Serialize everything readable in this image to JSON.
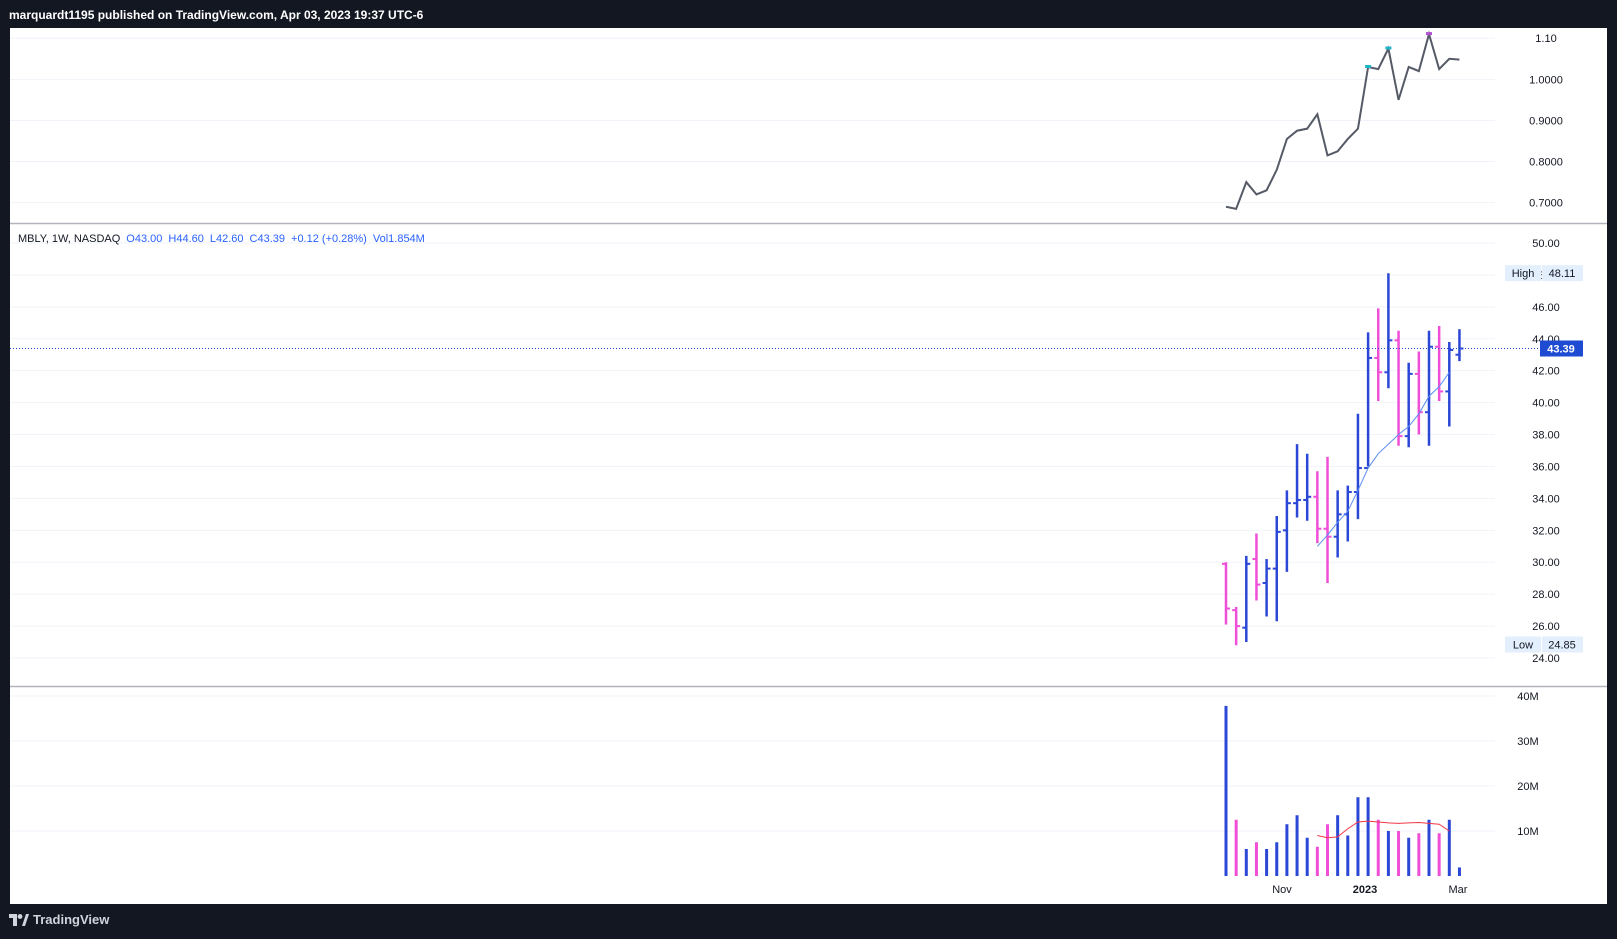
{
  "header": {
    "published_text": "marquardt1195 published on TradingView.com, Apr 03, 2023 19:37 UTC-6"
  },
  "footer": {
    "brand": "TradingView"
  },
  "legend": {
    "symbol": "MBLY, 1W, NASDAQ",
    "open": "O43.00",
    "high": "H44.60",
    "low": "L42.60",
    "close": "C43.39",
    "change": "+0.12 (+0.28%)",
    "volume": "Vol1.854M"
  },
  "colors": {
    "up": "#2b47d6",
    "down": "#ef4fd7",
    "ratio_line": "#555a66",
    "ma_price": "#5b8ff0",
    "ma_volume": "#f23645",
    "price_tag": "#1e4bd2"
  },
  "chart_data": [
    {
      "type": "line",
      "name": "ratio-indicator",
      "x": [
        "Oct 31",
        "Nov 07",
        "Nov 14",
        "Nov 21",
        "Nov 28",
        "Dec 05",
        "Dec 12",
        "Dec 19",
        "Dec 26",
        "Jan 02",
        "Jan 09",
        "Jan 16",
        "Jan 23",
        "Jan 30",
        "Feb 06",
        "Feb 13",
        "Feb 20",
        "Feb 27",
        "Mar 06",
        "Mar 13",
        "Mar 20",
        "Mar 27",
        "Apr 03"
      ],
      "values": [
        0.69,
        0.685,
        0.75,
        0.72,
        0.73,
        0.78,
        0.855,
        0.875,
        0.88,
        0.915,
        0.815,
        0.825,
        0.855,
        0.88,
        1.03,
        1.025,
        1.075,
        0.95,
        1.03,
        1.02,
        1.11,
        1.025,
        1.05,
        1.048
      ],
      "y_ticks": [
        "1.10",
        "1.0000",
        "0.9000",
        "0.8000",
        "0.7000"
      ],
      "ylim": [
        0.67,
        1.12
      ]
    },
    {
      "type": "ohlc",
      "name": "price",
      "x": [
        "Oct 31",
        "Nov 07",
        "Nov 14",
        "Nov 21",
        "Nov 28",
        "Dec 05",
        "Dec 12",
        "Dec 19",
        "Dec 26",
        "Jan 02",
        "Jan 09",
        "Jan 16",
        "Jan 23",
        "Jan 30",
        "Feb 06",
        "Feb 13",
        "Feb 20",
        "Feb 27",
        "Mar 06",
        "Mar 13",
        "Mar 20",
        "Mar 27",
        "Apr 03"
      ],
      "ohlc": [
        [
          29.9,
          30.0,
          26.1,
          27.1
        ],
        [
          27.0,
          27.2,
          24.8,
          26.0
        ],
        [
          25.9,
          30.4,
          25.0,
          29.9
        ],
        [
          30.2,
          31.8,
          27.6,
          28.6
        ],
        [
          28.7,
          30.2,
          26.6,
          29.6
        ],
        [
          29.6,
          32.9,
          26.3,
          31.9
        ],
        [
          32.0,
          34.5,
          29.4,
          33.7
        ],
        [
          33.7,
          37.4,
          32.8,
          33.9
        ],
        [
          33.9,
          36.8,
          32.6,
          34.1
        ],
        [
          34.1,
          35.7,
          31.2,
          32.1
        ],
        [
          32.1,
          36.6,
          28.7,
          31.6
        ],
        [
          31.6,
          34.5,
          30.3,
          33.0
        ],
        [
          33.0,
          34.8,
          31.3,
          34.4
        ],
        [
          34.4,
          39.3,
          32.7,
          35.9
        ],
        [
          35.9,
          44.4,
          36.0,
          42.8
        ],
        [
          42.8,
          45.9,
          40.1,
          41.9
        ],
        [
          41.9,
          48.1,
          40.9,
          43.9
        ],
        [
          43.9,
          44.5,
          37.3,
          37.9
        ],
        [
          37.9,
          42.5,
          37.2,
          41.8
        ],
        [
          41.8,
          43.2,
          38.0,
          39.4
        ],
        [
          39.4,
          44.5,
          37.3,
          43.5
        ],
        [
          43.5,
          44.8,
          40.1,
          40.7
        ],
        [
          40.7,
          43.8,
          38.5,
          43.3
        ],
        [
          43.0,
          44.6,
          42.6,
          43.39
        ]
      ],
      "ma": [
        null,
        null,
        null,
        null,
        null,
        null,
        null,
        null,
        null,
        31.0,
        31.7,
        32.5,
        33.2,
        34.5,
        35.9,
        36.8,
        37.4,
        38.0,
        38.5,
        39.3,
        40.4,
        41.0,
        41.9
      ],
      "y_ticks": [
        "50.00",
        "48.00",
        "46.00",
        "44.00",
        "42.00",
        "40.00",
        "38.00",
        "36.00",
        "34.00",
        "32.00",
        "30.00",
        "28.00",
        "26.00",
        "24.00"
      ],
      "ylim": [
        23.5,
        50.5
      ],
      "high_label": "High",
      "high_value": "48.11",
      "low_label": "Low",
      "low_value": "24.85",
      "last_price": "43.39"
    },
    {
      "type": "bar",
      "name": "volume",
      "x": [
        "Oct 31",
        "Nov 07",
        "Nov 14",
        "Nov 21",
        "Nov 28",
        "Dec 05",
        "Dec 12",
        "Dec 19",
        "Dec 26",
        "Jan 02",
        "Jan 09",
        "Jan 16",
        "Jan 23",
        "Jan 30",
        "Feb 06",
        "Feb 13",
        "Feb 20",
        "Feb 27",
        "Mar 06",
        "Mar 13",
        "Mar 20",
        "Mar 27",
        "Apr 03"
      ],
      "values": [
        37.8,
        12.5,
        6.0,
        7.5,
        6.0,
        7.5,
        11.5,
        13.5,
        8.5,
        6.5,
        11.5,
        13.5,
        9.0,
        17.5,
        17.5,
        12.5,
        10.0,
        10.0,
        8.5,
        9.5,
        12.5,
        9.5,
        12.5,
        1.9
      ],
      "up": [
        true,
        false,
        true,
        false,
        true,
        true,
        true,
        true,
        true,
        false,
        false,
        true,
        true,
        true,
        true,
        false,
        true,
        false,
        true,
        false,
        true,
        false,
        true,
        true
      ],
      "ma": [
        null,
        null,
        null,
        null,
        null,
        null,
        null,
        null,
        null,
        9.0,
        8.5,
        8.7,
        10.5,
        12.0,
        12.2,
        12.0,
        11.8,
        11.7,
        11.8,
        11.9,
        11.7,
        11.5,
        10.0
      ],
      "y_ticks": [
        "40M",
        "30M",
        "20M",
        "10M"
      ],
      "ylim": [
        0,
        40
      ]
    }
  ],
  "x_axis_labels": [
    "Nov",
    "2023",
    "Mar"
  ]
}
